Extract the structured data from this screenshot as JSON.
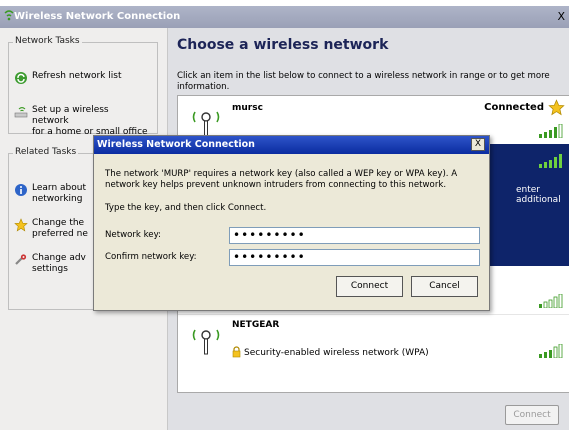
{
  "window": {
    "title": "Wireless Network Connection",
    "close_glyph": "X"
  },
  "left": {
    "network_tasks": {
      "title": "Network Tasks",
      "items": [
        {
          "label": "Refresh network list",
          "icon": "refresh-icon"
        },
        {
          "label": "Set up a wireless network\nfor a home or small office",
          "icon": "setup-wireless-icon"
        }
      ]
    },
    "related_tasks": {
      "title": "Related Tasks",
      "items": [
        {
          "label": "Learn about\nnetworking",
          "icon": "info-icon"
        },
        {
          "label": "Change the\npreferred ne",
          "icon": "star-icon"
        },
        {
          "label": "Change adv\nsettings",
          "icon": "settings-icon"
        }
      ]
    }
  },
  "main": {
    "heading": "Choose a wireless network",
    "instruction": "Click an item in the list below to connect to a wireless network in range or to get more information.",
    "networks": [
      {
        "name": "mursc",
        "status": "Connected",
        "security": "",
        "signal": 4
      },
      {
        "name": "",
        "status": "",
        "security": "enter additional",
        "signal": 4
      },
      {
        "name": "",
        "status": "",
        "security": "",
        "signal": 1
      },
      {
        "name": "NETGEAR",
        "status": "",
        "security": "Security-enabled wireless network (WPA)",
        "signal": 3
      }
    ],
    "connect_button": "Connect"
  },
  "dialog": {
    "title": "Wireless Network Connection",
    "close_glyph": "X",
    "message": "The network 'MURP' requires a network key (also called a WEP key or WPA key). A network key helps prevent unknown intruders from connecting to this network.",
    "type_instruction": "Type the key, and then click Connect.",
    "network_key_label": "Network key:",
    "network_key_value": "•••••••••",
    "confirm_key_label": "Confirm network key:",
    "confirm_key_value": "•••••••••",
    "connect_label": "Connect",
    "cancel_label": "Cancel"
  },
  "colors": {
    "selected_row": "#0e246a",
    "dialog_title": "#0a2ca0",
    "heading": "#1c2457",
    "signal_green": "#3a9a22"
  }
}
